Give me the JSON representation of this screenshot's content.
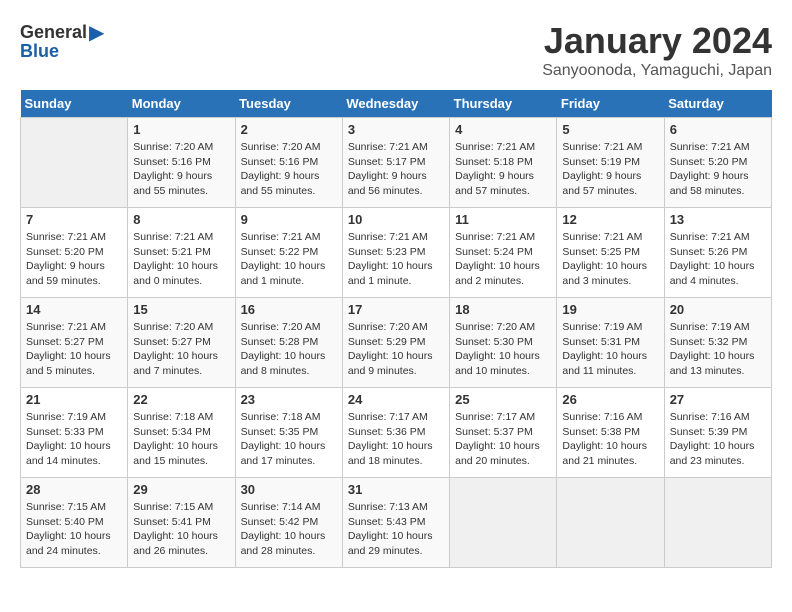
{
  "logo": {
    "general": "General",
    "blue": "Blue"
  },
  "title": "January 2024",
  "location": "Sanyoonoda, Yamaguchi, Japan",
  "weekdays": [
    "Sunday",
    "Monday",
    "Tuesday",
    "Wednesday",
    "Thursday",
    "Friday",
    "Saturday"
  ],
  "weeks": [
    [
      {
        "day": "",
        "info": ""
      },
      {
        "day": "1",
        "info": "Sunrise: 7:20 AM\nSunset: 5:16 PM\nDaylight: 9 hours\nand 55 minutes."
      },
      {
        "day": "2",
        "info": "Sunrise: 7:20 AM\nSunset: 5:16 PM\nDaylight: 9 hours\nand 55 minutes."
      },
      {
        "day": "3",
        "info": "Sunrise: 7:21 AM\nSunset: 5:17 PM\nDaylight: 9 hours\nand 56 minutes."
      },
      {
        "day": "4",
        "info": "Sunrise: 7:21 AM\nSunset: 5:18 PM\nDaylight: 9 hours\nand 57 minutes."
      },
      {
        "day": "5",
        "info": "Sunrise: 7:21 AM\nSunset: 5:19 PM\nDaylight: 9 hours\nand 57 minutes."
      },
      {
        "day": "6",
        "info": "Sunrise: 7:21 AM\nSunset: 5:20 PM\nDaylight: 9 hours\nand 58 minutes."
      }
    ],
    [
      {
        "day": "7",
        "info": "Sunrise: 7:21 AM\nSunset: 5:20 PM\nDaylight: 9 hours\nand 59 minutes."
      },
      {
        "day": "8",
        "info": "Sunrise: 7:21 AM\nSunset: 5:21 PM\nDaylight: 10 hours\nand 0 minutes."
      },
      {
        "day": "9",
        "info": "Sunrise: 7:21 AM\nSunset: 5:22 PM\nDaylight: 10 hours\nand 1 minute."
      },
      {
        "day": "10",
        "info": "Sunrise: 7:21 AM\nSunset: 5:23 PM\nDaylight: 10 hours\nand 1 minute."
      },
      {
        "day": "11",
        "info": "Sunrise: 7:21 AM\nSunset: 5:24 PM\nDaylight: 10 hours\nand 2 minutes."
      },
      {
        "day": "12",
        "info": "Sunrise: 7:21 AM\nSunset: 5:25 PM\nDaylight: 10 hours\nand 3 minutes."
      },
      {
        "day": "13",
        "info": "Sunrise: 7:21 AM\nSunset: 5:26 PM\nDaylight: 10 hours\nand 4 minutes."
      }
    ],
    [
      {
        "day": "14",
        "info": "Sunrise: 7:21 AM\nSunset: 5:27 PM\nDaylight: 10 hours\nand 5 minutes."
      },
      {
        "day": "15",
        "info": "Sunrise: 7:20 AM\nSunset: 5:27 PM\nDaylight: 10 hours\nand 7 minutes."
      },
      {
        "day": "16",
        "info": "Sunrise: 7:20 AM\nSunset: 5:28 PM\nDaylight: 10 hours\nand 8 minutes."
      },
      {
        "day": "17",
        "info": "Sunrise: 7:20 AM\nSunset: 5:29 PM\nDaylight: 10 hours\nand 9 minutes."
      },
      {
        "day": "18",
        "info": "Sunrise: 7:20 AM\nSunset: 5:30 PM\nDaylight: 10 hours\nand 10 minutes."
      },
      {
        "day": "19",
        "info": "Sunrise: 7:19 AM\nSunset: 5:31 PM\nDaylight: 10 hours\nand 11 minutes."
      },
      {
        "day": "20",
        "info": "Sunrise: 7:19 AM\nSunset: 5:32 PM\nDaylight: 10 hours\nand 13 minutes."
      }
    ],
    [
      {
        "day": "21",
        "info": "Sunrise: 7:19 AM\nSunset: 5:33 PM\nDaylight: 10 hours\nand 14 minutes."
      },
      {
        "day": "22",
        "info": "Sunrise: 7:18 AM\nSunset: 5:34 PM\nDaylight: 10 hours\nand 15 minutes."
      },
      {
        "day": "23",
        "info": "Sunrise: 7:18 AM\nSunset: 5:35 PM\nDaylight: 10 hours\nand 17 minutes."
      },
      {
        "day": "24",
        "info": "Sunrise: 7:17 AM\nSunset: 5:36 PM\nDaylight: 10 hours\nand 18 minutes."
      },
      {
        "day": "25",
        "info": "Sunrise: 7:17 AM\nSunset: 5:37 PM\nDaylight: 10 hours\nand 20 minutes."
      },
      {
        "day": "26",
        "info": "Sunrise: 7:16 AM\nSunset: 5:38 PM\nDaylight: 10 hours\nand 21 minutes."
      },
      {
        "day": "27",
        "info": "Sunrise: 7:16 AM\nSunset: 5:39 PM\nDaylight: 10 hours\nand 23 minutes."
      }
    ],
    [
      {
        "day": "28",
        "info": "Sunrise: 7:15 AM\nSunset: 5:40 PM\nDaylight: 10 hours\nand 24 minutes."
      },
      {
        "day": "29",
        "info": "Sunrise: 7:15 AM\nSunset: 5:41 PM\nDaylight: 10 hours\nand 26 minutes."
      },
      {
        "day": "30",
        "info": "Sunrise: 7:14 AM\nSunset: 5:42 PM\nDaylight: 10 hours\nand 28 minutes."
      },
      {
        "day": "31",
        "info": "Sunrise: 7:13 AM\nSunset: 5:43 PM\nDaylight: 10 hours\nand 29 minutes."
      },
      {
        "day": "",
        "info": ""
      },
      {
        "day": "",
        "info": ""
      },
      {
        "day": "",
        "info": ""
      }
    ]
  ]
}
